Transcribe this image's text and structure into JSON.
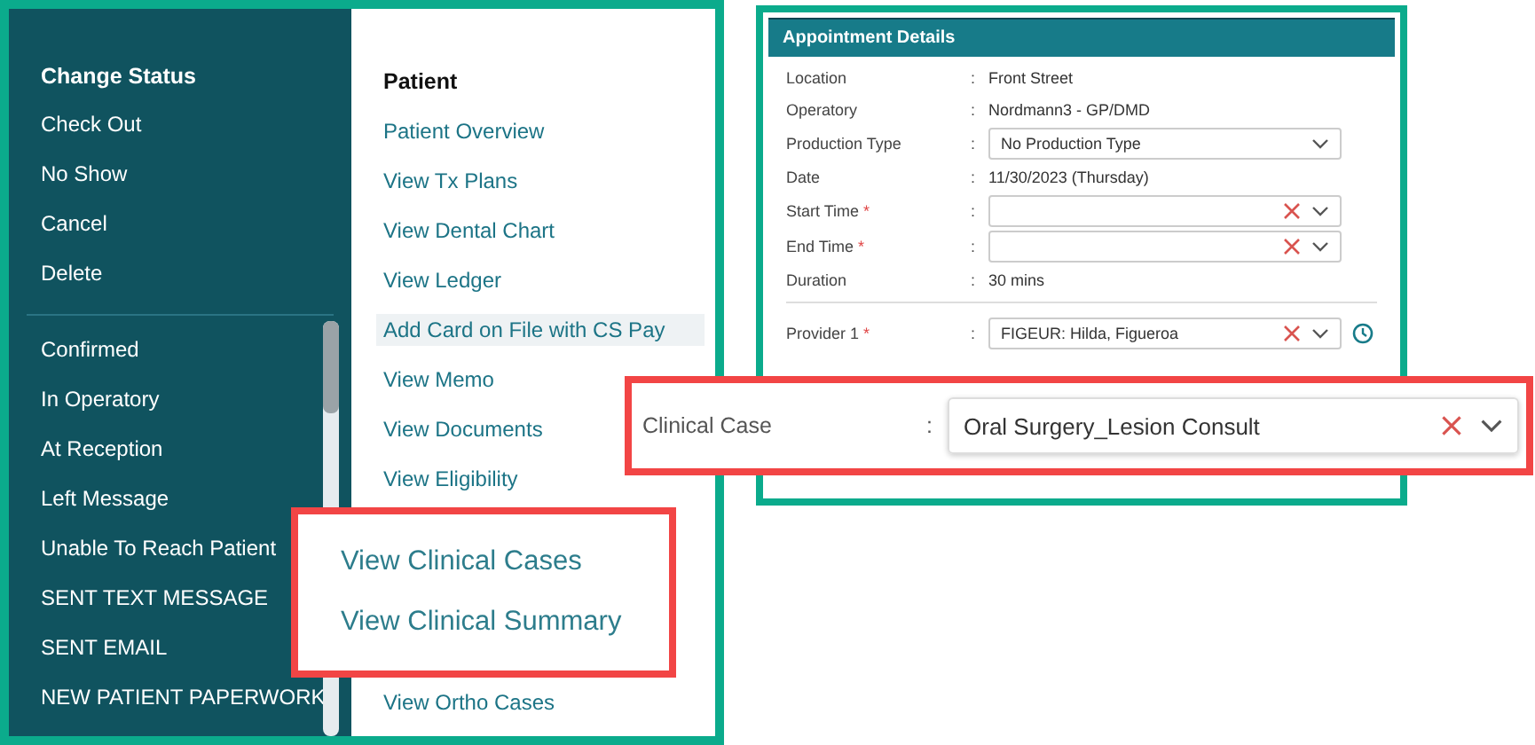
{
  "status_menu": {
    "title": "Change Status",
    "actions": [
      "Check Out",
      "No Show",
      "Cancel",
      "Delete"
    ],
    "statuses": [
      "Confirmed",
      "In Operatory",
      "At Reception",
      "Left Message",
      "Unable To Reach Patient",
      "SENT TEXT MESSAGE",
      "SENT EMAIL",
      "NEW PATIENT PAPERWORK"
    ]
  },
  "patient_menu": {
    "title": "Patient",
    "items": [
      {
        "label": "Patient Overview",
        "hovered": false
      },
      {
        "label": "View Tx Plans",
        "hovered": false
      },
      {
        "label": "View Dental Chart",
        "hovered": false
      },
      {
        "label": "View Ledger",
        "hovered": false
      },
      {
        "label": "Add Card on File with CS Pay",
        "hovered": true
      },
      {
        "label": "View Memo",
        "hovered": false
      },
      {
        "label": "View Documents",
        "hovered": false
      },
      {
        "label": "View Eligibility",
        "hovered": false
      }
    ],
    "lower_items": [
      {
        "label": "View Ortho Cases",
        "hovered": false
      }
    ]
  },
  "appointment": {
    "title": "Appointment Details",
    "separator": ":",
    "required_mark": "*",
    "fields": [
      {
        "kind": "text",
        "label": "Location",
        "required": false,
        "value": "Front Street"
      },
      {
        "kind": "text",
        "label": "Operatory",
        "required": false,
        "value": "Nordmann3 - GP/DMD"
      },
      {
        "kind": "select",
        "label": "Production Type",
        "required": false,
        "value": "No Production Type"
      },
      {
        "kind": "text",
        "label": "Date",
        "required": false,
        "value": "11/30/2023 (Thursday)"
      },
      {
        "kind": "clearable",
        "label": "Start Time",
        "required": true
      },
      {
        "kind": "clearable",
        "label": "End Time",
        "required": true
      },
      {
        "kind": "text",
        "label": "Duration",
        "required": false,
        "value": "30 mins"
      }
    ],
    "provider": {
      "label": "Provider 1",
      "required": true,
      "value": "FIGEUR: Hilda, Figueroa"
    }
  },
  "case_callout": {
    "label": "Clinical Case",
    "separator": ":",
    "value": "Oral Surgery_Lesion Consult"
  },
  "links_callout": [
    "View Clinical Cases",
    "View Clinical Summary"
  ]
}
